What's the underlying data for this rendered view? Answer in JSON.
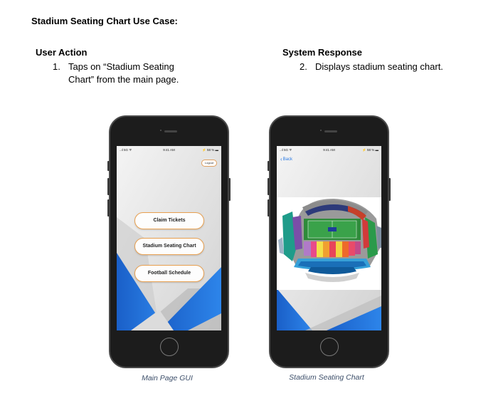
{
  "document": {
    "title": "Stadium Seating Chart Use Case:",
    "user_action_heading": "User Action",
    "system_response_heading": "System Response",
    "user_steps": [
      {
        "num": "1.",
        "line1": "Taps   on   “Stadium   Seating",
        "line2": "Chart” from the main page."
      }
    ],
    "system_steps": [
      {
        "num": "2.",
        "text": "Displays stadium seating chart."
      }
    ]
  },
  "left_phone": {
    "caption": "Main Page GUI",
    "status": {
      "signal": "..ıl 5G ᯤ",
      "time": "9:41 AM",
      "battery": "⚡ 58 % ▬"
    },
    "logout_label": "Logout",
    "buttons": [
      "Claim Tickets",
      "Stadium Seating Chart",
      "Football Schedule"
    ]
  },
  "right_phone": {
    "caption": "Stadium Seating Chart",
    "status": {
      "signal": "..ıl 5G ᯤ",
      "time": "9:41 AM",
      "battery": "⚡ 58 % ▬"
    },
    "back_label": "Back",
    "back_icon": "chevron-left-icon"
  },
  "colors": {
    "button_border": "#e8a050",
    "accent_blue": "#1e6fd6",
    "ios_link": "#2a7ae4"
  }
}
